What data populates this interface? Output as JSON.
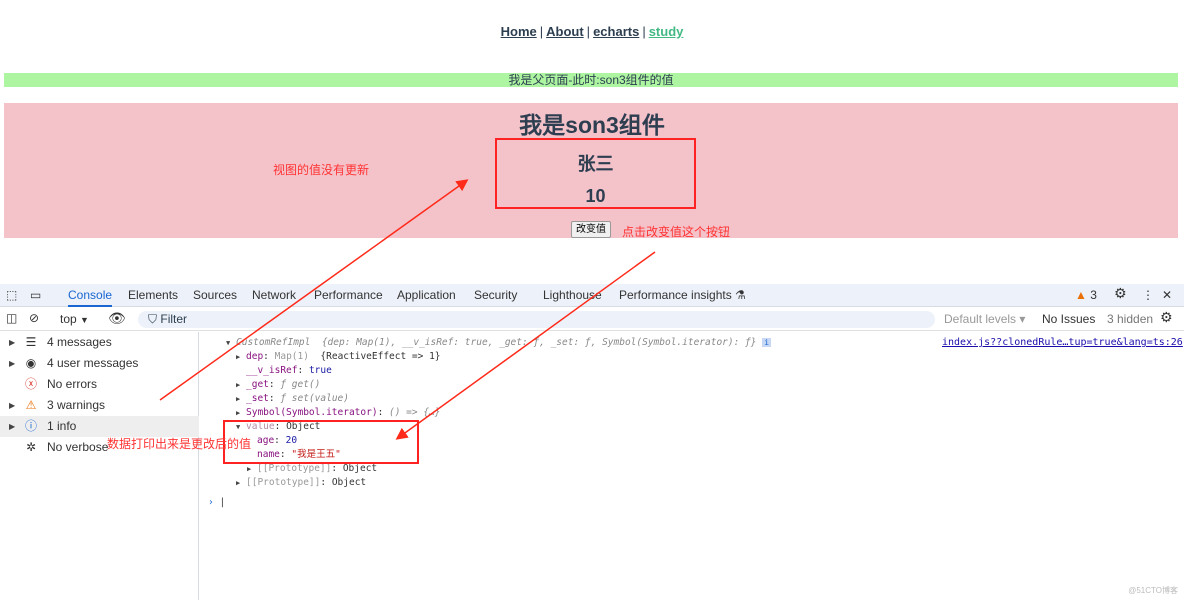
{
  "nav": {
    "items": [
      {
        "label": "Home"
      },
      {
        "label": "About"
      },
      {
        "label": "echarts"
      },
      {
        "label": "study",
        "active": true
      }
    ],
    "separator": "|"
  },
  "parent": {
    "text": "我是父页面-此时:son3组件的值"
  },
  "son3": {
    "title": "我是son3组件",
    "name": "张三",
    "age": "10",
    "button": "改变值"
  },
  "annotations": {
    "view_not_updated": "视图的值没有更新",
    "click_button": "点击改变值这个按钮",
    "data_changed": "数据打印出来是更改后的值",
    "color": "#ff2a1a"
  },
  "devtools": {
    "tabs": [
      "Console",
      "Elements",
      "Sources",
      "Network",
      "Performance",
      "Application",
      "Security",
      "Lighthouse",
      "Performance insights"
    ],
    "active_tab": "Console",
    "warning_count": "3",
    "context": "top",
    "filter_placeholder": "Filter",
    "levels": "Default levels",
    "issues": "No Issues",
    "hidden": "3 hidden",
    "sidebar": [
      {
        "label": "4 messages",
        "icon": "list-icon"
      },
      {
        "label": "4 user messages",
        "icon": "user-icon"
      },
      {
        "label": "No errors",
        "icon": "error-icon"
      },
      {
        "label": "3 warnings",
        "icon": "warning-icon"
      },
      {
        "label": "1 info",
        "icon": "info-icon",
        "selected": true
      },
      {
        "label": "No verbose",
        "icon": "bug-icon"
      }
    ],
    "source_link": "index.js??clonedRule…tup=true&lang=ts:26",
    "log": {
      "head_name": "CustomRefImpl",
      "head_preview": "{dep: Map(1), __v_isRef: true, _get: ƒ, _set: ƒ, Symbol(Symbol.iterator): ƒ}",
      "dep_key": "dep",
      "dep_type": "Map(1)",
      "dep_val": "{ReactiveEffect => 1}",
      "isref_key": "__v_isRef",
      "isref_val": "true",
      "get_key": "_get",
      "get_val": "ƒ get()",
      "set_key": "_set",
      "set_val": "ƒ set(value)",
      "sym_key": "Symbol(Symbol.iterator)",
      "sym_val": "() => {…}",
      "value_key": "value",
      "value_type": "Object",
      "age_key": "age",
      "age_val": "20",
      "name_key": "name",
      "name_val": "\"我是王五\"",
      "proto_key": "[[Prototype]]",
      "proto_val": "Object"
    }
  },
  "watermark": "@51CTO博客"
}
